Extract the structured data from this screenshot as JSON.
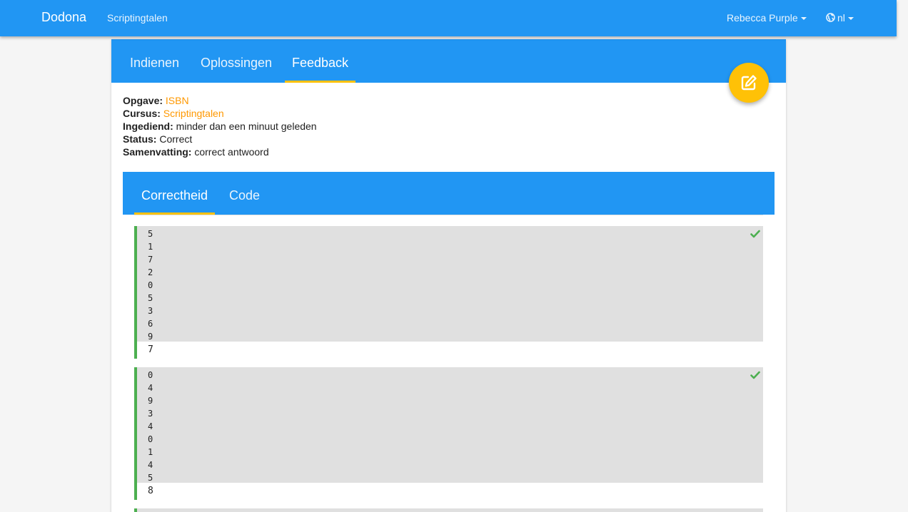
{
  "navbar": {
    "brand": "Dodona",
    "course": "Scriptingtalen",
    "user": "Rebecca Purple",
    "language": "nl"
  },
  "card": {
    "tabs": [
      {
        "label": "Indienen",
        "active": false
      },
      {
        "label": "Oplossingen",
        "active": false
      },
      {
        "label": "Feedback",
        "active": true
      }
    ],
    "edit_icon": "edit-icon"
  },
  "submission": {
    "exercise_label": "Opgave:",
    "exercise_value": "ISBN",
    "course_label": "Cursus:",
    "course_value": "Scriptingtalen",
    "submitted_label": "Ingediend:",
    "submitted_value": "minder dan een minuut geleden",
    "status_label": "Status:",
    "status_value": "Correct",
    "summary_label": "Samenvatting:",
    "summary_value": "correct antwoord"
  },
  "feedback": {
    "tabs": [
      {
        "label": "Correctheid",
        "active": true
      },
      {
        "label": "Code",
        "active": false
      }
    ],
    "testcases": [
      {
        "input": [
          "5",
          "1",
          "7",
          "2",
          "0",
          "5",
          "3",
          "6",
          "9"
        ],
        "output": "7",
        "status": "correct"
      },
      {
        "input": [
          "0",
          "4",
          "9",
          "3",
          "4",
          "0",
          "1",
          "4",
          "5"
        ],
        "output": "8",
        "status": "correct"
      }
    ]
  },
  "colors": {
    "primary": "#2196f3",
    "accent": "#ffc107",
    "link": "#ff9800",
    "success": "#4caf50"
  }
}
